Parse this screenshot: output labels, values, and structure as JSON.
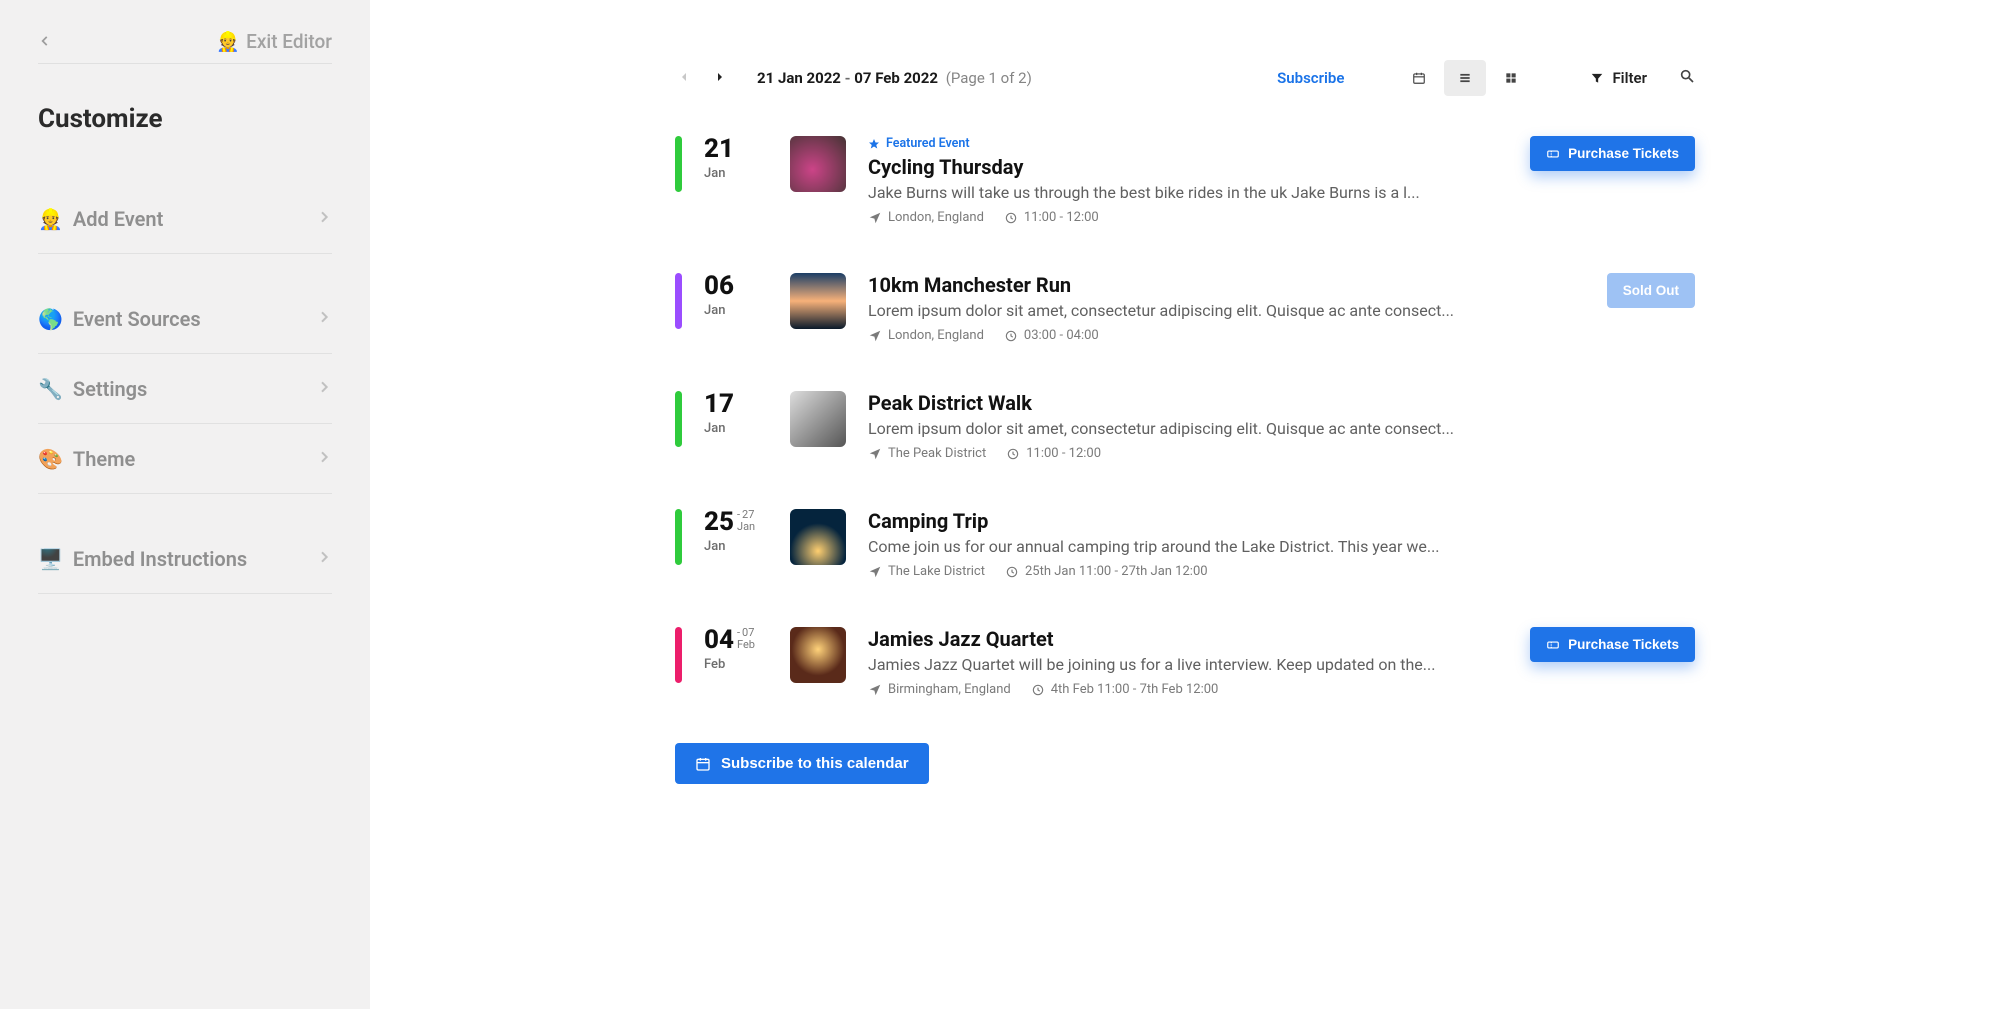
{
  "sidebar": {
    "exit_label": "Exit Editor",
    "title": "Customize",
    "items": [
      {
        "emoji": "👷",
        "label": "Add Event"
      },
      {
        "emoji": "🌎",
        "label": "Event Sources"
      },
      {
        "emoji": "🔧",
        "label": "Settings"
      },
      {
        "emoji": "🎨",
        "label": "Theme"
      },
      {
        "emoji": "🖥️",
        "label": "Embed Instructions"
      }
    ]
  },
  "toolbar": {
    "start_date": "21 Jan 2022",
    "end_date": "07 Feb 2022",
    "page_info": "(Page 1 of 2)",
    "subscribe": "Subscribe",
    "filter": "Filter"
  },
  "colors": {
    "green": "#2fcb3c",
    "purple": "#9b4dff",
    "pink": "#ec1e6b"
  },
  "events": [
    {
      "day": "21",
      "month": "Jan",
      "bar_color": "#2fcb3c",
      "thumb_class": "th-1",
      "featured": "Featured Event",
      "title": "Cycling Thursday",
      "desc": "Jake Burns will take us through the best bike rides in the uk Jake Burns is a l...",
      "location": "London, England",
      "time": "11:00 - 12:00",
      "cta": "Purchase Tickets",
      "cta_disabled": false
    },
    {
      "day": "06",
      "month": "Jan",
      "bar_color": "#9b4dff",
      "thumb_class": "th-2",
      "title": "10km Manchester Run",
      "desc": "Lorem ipsum dolor sit amet, consectetur adipiscing elit. Quisque ac ante consect...",
      "location": "London, England",
      "time": "03:00 - 04:00",
      "cta": "Sold Out",
      "cta_disabled": true
    },
    {
      "day": "17",
      "month": "Jan",
      "bar_color": "#2fcb3c",
      "thumb_class": "th-3",
      "title": "Peak District Walk",
      "desc": "Lorem ipsum dolor sit amet, consectetur adipiscing elit. Quisque ac ante consect...",
      "location": "The Peak District",
      "time": "11:00 - 12:00"
    },
    {
      "day": "25",
      "month": "Jan",
      "end_day": "27",
      "end_month": "Jan",
      "bar_color": "#2fcb3c",
      "thumb_class": "th-4",
      "title": "Camping Trip",
      "desc": "Come join us for our annual camping trip around the Lake District. This year we...",
      "location": "The Lake District",
      "time": "25th Jan 11:00 - 27th Jan 12:00"
    },
    {
      "day": "04",
      "month": "Feb",
      "end_day": "07",
      "end_month": "Feb",
      "bar_color": "#ec1e6b",
      "thumb_class": "th-5",
      "title": "Jamies Jazz Quartet",
      "desc": "Jamies Jazz Quartet will be joining us for a live interview. Keep updated on the...",
      "location": "Birmingham, England",
      "time": "4th Feb 11:00 - 7th Feb 12:00",
      "cta": "Purchase Tickets",
      "cta_disabled": false
    }
  ],
  "subscribe_calendar": "Subscribe to this calendar"
}
